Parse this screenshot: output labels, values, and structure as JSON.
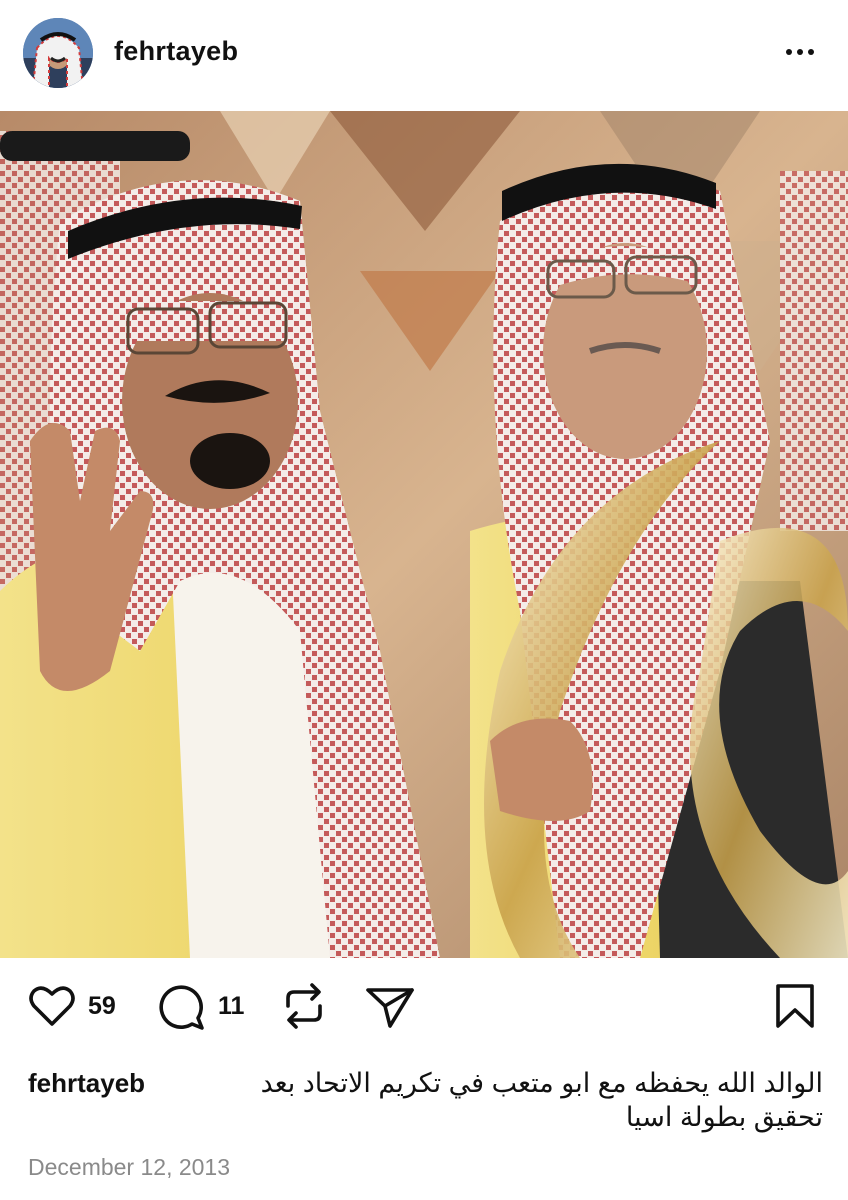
{
  "post": {
    "username": "fehrtayeb",
    "more_label": "More options",
    "photo_alt": "",
    "likes": "59",
    "comments": "11",
    "caption_user": "fehrtayeb",
    "caption_text": "الوالد الله يحفظه مع ابو متعب في تكريم الاتحاد بعد تحقيق بطولة اسيا",
    "date": "December 12, 2013"
  },
  "icons": {
    "avatar": "avatar",
    "more": "more-horizontal-icon",
    "like": "heart-icon",
    "comment": "comment-bubble-icon",
    "repost": "repost-icon",
    "share": "send-icon",
    "save": "bookmark-icon"
  },
  "colors": {
    "text": "#111111",
    "muted": "#8a8a8a",
    "background": "#ffffff"
  }
}
